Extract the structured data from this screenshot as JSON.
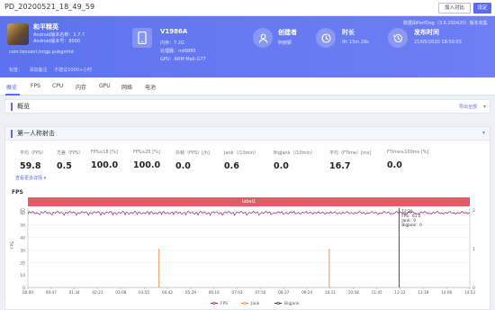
{
  "topbar": {
    "title": "PD_20200521_18_49_59",
    "compare_label": "加入对比",
    "settings_label": "设定"
  },
  "app": {
    "name": "和平精英",
    "version_name": "Android版本名称：1.7.7",
    "version_code": "Android版本号：8000",
    "package": "com.tencent.tmgp.pubgmhd",
    "links": [
      "标签：",
      "添加备注",
      "不建议1000+小时"
    ]
  },
  "device": {
    "model": "V1986A",
    "memory": "内存：7.2G",
    "processor": "处理器：mt6885",
    "gpu": "GPU：ARM Mali-G77"
  },
  "creator": {
    "title": "创建者",
    "value": "阿丽颖"
  },
  "duration": {
    "title": "时长",
    "value": "0h 15m 28s"
  },
  "release": {
    "title": "发布时间",
    "value": "21/05/2020 18:50:03"
  },
  "data_source": "数据由PerfDog（3.6.200420）版本收集",
  "tabs": [
    "概览",
    "FPS",
    "CPU",
    "内存",
    "GPU",
    "网络",
    "电池"
  ],
  "overview": {
    "title": "概览",
    "export_label": "导出全部"
  },
  "scene": {
    "title": "第一人称射击",
    "more_label": "查看更多详情 ▾",
    "metrics": [
      {
        "label": "平均（FPS）",
        "value": "59.8"
      },
      {
        "label": "方差（FPS）",
        "value": "0.5"
      },
      {
        "label": "FPS≥18 [%]",
        "value": "100.0"
      },
      {
        "label": "FPS≥25 [%]",
        "value": "100.0"
      },
      {
        "label": "抖帧（FPS）[/h]",
        "value": "0.0"
      },
      {
        "label": "Jank（/10min）",
        "value": "0.6"
      },
      {
        "label": "BigJank（/10min）",
        "value": "0.0"
      },
      {
        "label": "平均（FTime）[ms]",
        "value": "16.7"
      },
      {
        "label": "FTime≥100ms [%]",
        "value": "0.0"
      }
    ]
  },
  "chart_data": {
    "type": "line",
    "title": "FPS",
    "ylabel": "FPS",
    "band_label": "label1",
    "x_ticks": [
      "00:00",
      "00:47",
      "01:34",
      "02:21",
      "03:08",
      "03:55",
      "04:42",
      "05:29",
      "06:16",
      "07:03",
      "07:50",
      "08:37",
      "09:24",
      "10:11",
      "10:58",
      "11:45",
      "12:32",
      "13:19",
      "14:06",
      "14:53"
    ],
    "y_ticks": [
      "62",
      "60",
      "50",
      "40",
      "30",
      "20",
      "10",
      "0"
    ],
    "ylim": [
      0,
      62
    ],
    "y2_ticks": [
      "2",
      "1",
      "0"
    ],
    "series": [
      {
        "name": "FPS",
        "color": "#a0246e",
        "mean": 59.8
      },
      {
        "name": "Jank",
        "color": "#f08a40",
        "spikes": [
          {
            "x": "04:25",
            "y": 1
          },
          {
            "x": "10:09",
            "y": 1
          }
        ]
      },
      {
        "name": "BigJank",
        "color": "#3a3a3a",
        "spikes": [
          {
            "x": "12:30",
            "y": 2
          }
        ]
      }
    ],
    "tooltip": {
      "time": "12:30",
      "lines": [
        "FPS：61.0",
        "Jank：0",
        "BigJank：0"
      ]
    },
    "legend": [
      "FPS",
      "Jank",
      "BigJank"
    ],
    "legend_position": "bottom"
  }
}
